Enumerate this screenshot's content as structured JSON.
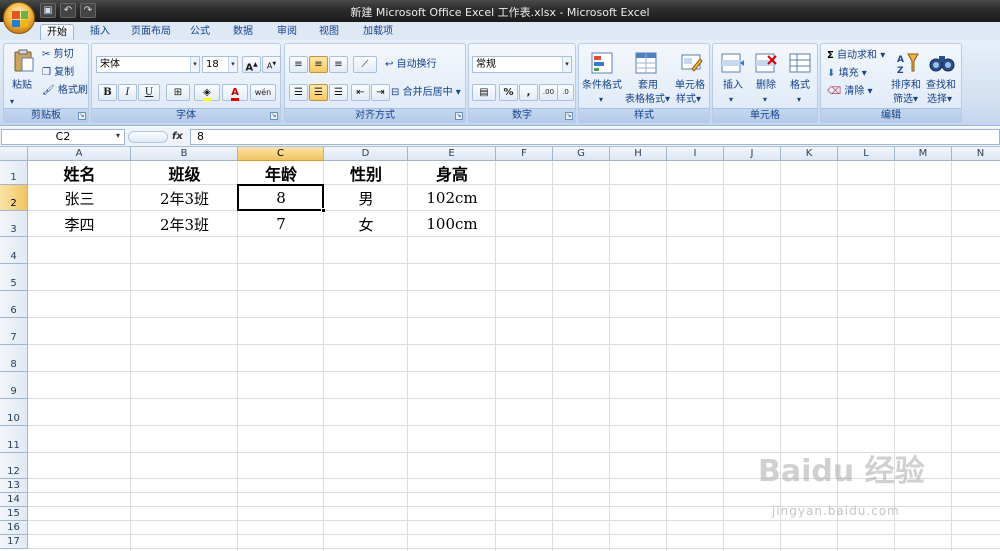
{
  "window": {
    "title": "新建 Microsoft Office Excel 工作表.xlsx - Microsoft Excel"
  },
  "qat": {
    "save": "save-icon",
    "undo": "undo-icon",
    "redo": "redo-icon"
  },
  "tabs": [
    "开始",
    "插入",
    "页面布局",
    "公式",
    "数据",
    "审阅",
    "视图",
    "加载项"
  ],
  "active_tab": "开始",
  "ribbon": {
    "clipboard": {
      "label": "剪贴板",
      "paste": "粘贴",
      "cut": "剪切",
      "copy": "复制",
      "format_painter": "格式刷"
    },
    "font": {
      "label": "字体",
      "font_name": "宋体",
      "font_size": "18",
      "bold": "B",
      "italic": "I",
      "underline": "U",
      "grow": "A",
      "shrink": "A",
      "phonetic": "wén"
    },
    "alignment": {
      "label": "对齐方式",
      "wrap_text": "自动换行",
      "merge_center": "合并后居中"
    },
    "number": {
      "label": "数字",
      "format": "常规",
      "percent": "%",
      "comma": ",",
      "inc_decimal": ".00",
      "dec_decimal": ".0"
    },
    "styles": {
      "label": "样式",
      "conditional_1": "条件格式",
      "table_1": "套用",
      "table_2": "表格格式",
      "cell_1": "单元格",
      "cell_2": "样式"
    },
    "cells": {
      "label": "单元格",
      "insert": "插入",
      "delete": "删除",
      "format": "格式"
    },
    "editing": {
      "label": "编辑",
      "autosum": "自动求和",
      "fill": "填充",
      "clear": "清除",
      "sort_1": "排序和",
      "sort_2": "筛选",
      "find_1": "查找和",
      "find_2": "选择"
    }
  },
  "formula_bar": {
    "name_box": "C2",
    "fx": "fx",
    "value": "8"
  },
  "sheet": {
    "columns": [
      "A",
      "B",
      "C",
      "D",
      "E",
      "F",
      "G",
      "H",
      "I",
      "J",
      "K",
      "L",
      "M",
      "N"
    ],
    "rows": [
      "1",
      "2",
      "3",
      "4",
      "5",
      "6",
      "7",
      "8",
      "9",
      "10",
      "11",
      "12",
      "13",
      "14",
      "15",
      "16",
      "17"
    ],
    "active_cell": "C2",
    "table": {
      "headers": [
        "姓名",
        "班级",
        "年龄",
        "性别",
        "身高"
      ],
      "rows": [
        [
          "张三",
          "2年3班",
          "8",
          "男",
          "102cm"
        ],
        [
          "李四",
          "2年3班",
          "7",
          "女",
          "100cm"
        ]
      ]
    }
  },
  "watermark": {
    "text": "Baidu 经验",
    "url": "jingyan.baidu.com"
  },
  "colors": {
    "accent": "#15428b",
    "selected_header": "#f2c463",
    "grid": "#dadcdd"
  }
}
